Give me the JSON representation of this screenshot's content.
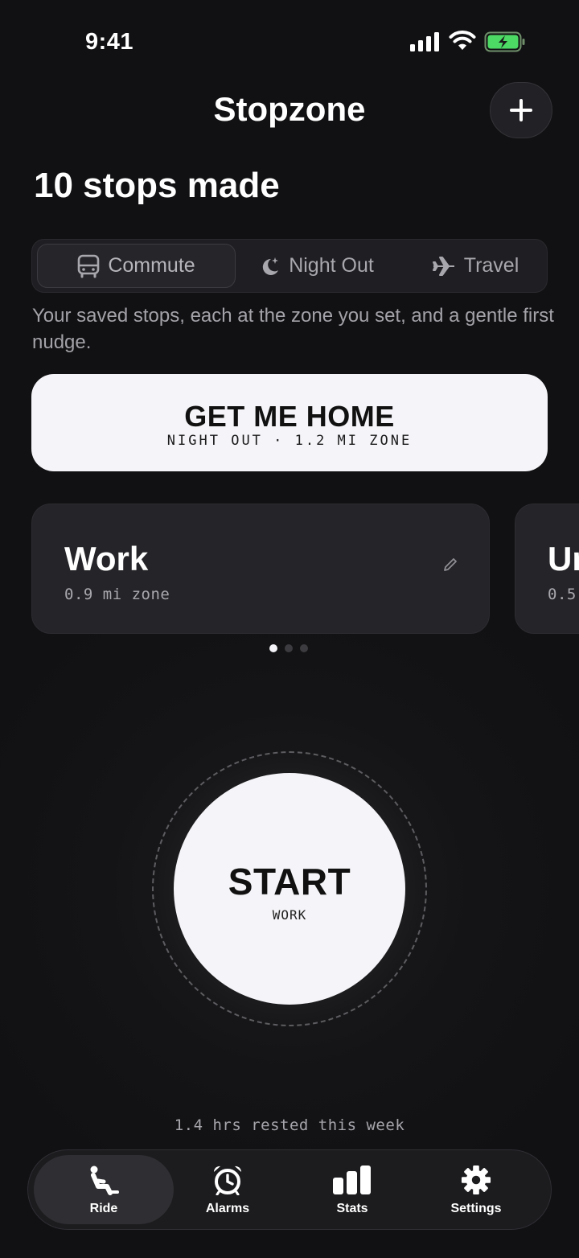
{
  "status_bar": {
    "time": "9:41"
  },
  "header": {
    "title": "Stopzone",
    "stops_count": "10 stops made"
  },
  "modes": [
    {
      "label": "Commute",
      "icon": "bus-icon",
      "active": true
    },
    {
      "label": "Night Out",
      "icon": "moon-stars-icon",
      "active": false
    },
    {
      "label": "Travel",
      "icon": "airplane-icon",
      "active": false
    }
  ],
  "description": "Your saved stops, each at the zone you set, and a gentle first nudge.",
  "home_button": {
    "title": "GET ME HOME",
    "subtitle": "NIGHT OUT · 1.2 MI ZONE"
  },
  "stops": [
    {
      "name": "Work",
      "zone": "0.9 mi zone"
    },
    {
      "name": "Un",
      "zone": "0.5"
    }
  ],
  "pager": {
    "count": 3,
    "active_index": 0
  },
  "start": {
    "label": "START",
    "stop": "WORK"
  },
  "rested": "1.4 hrs rested this week",
  "tabs": [
    {
      "label": "Ride",
      "icon": "seat-person-icon",
      "active": true
    },
    {
      "label": "Alarms",
      "icon": "alarm-clock-icon",
      "active": false
    },
    {
      "label": "Stats",
      "icon": "bar-chart-icon",
      "active": false
    },
    {
      "label": "Settings",
      "icon": "gear-icon",
      "active": false
    }
  ],
  "colors": {
    "background": "#111113",
    "card": "#252529",
    "button_light": "#f5f4f8",
    "battery_green": "#4cd964"
  }
}
